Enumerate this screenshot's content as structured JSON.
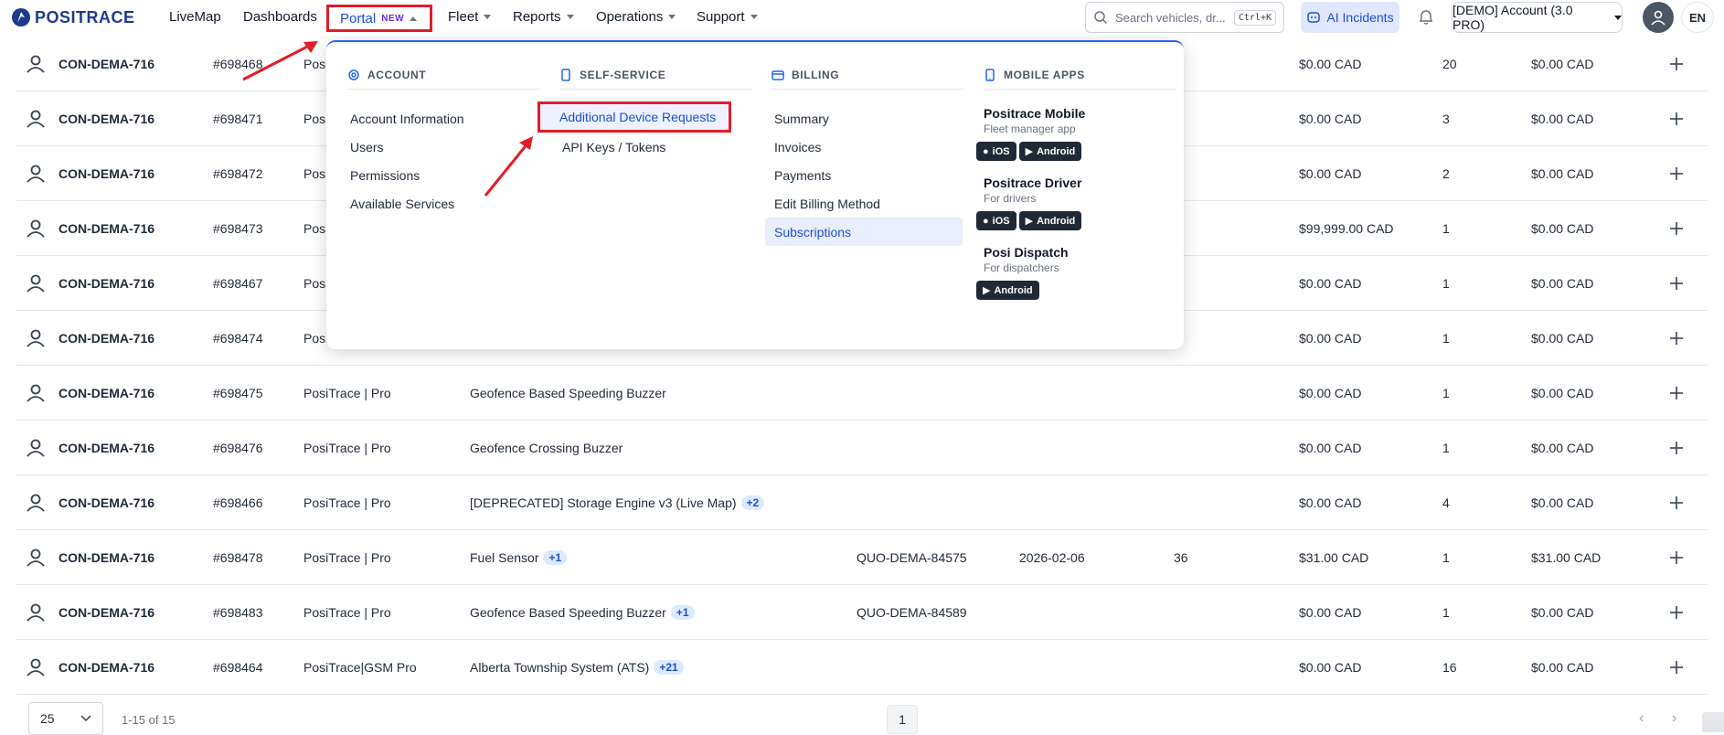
{
  "nav": {
    "logo": "POSITRACE",
    "items": [
      {
        "label": "LiveMap"
      },
      {
        "label": "Dashboards"
      },
      {
        "label": "Portal",
        "badge": "NEW"
      },
      {
        "label": "Fleet"
      },
      {
        "label": "Reports"
      },
      {
        "label": "Operations"
      },
      {
        "label": "Support"
      }
    ],
    "search_placeholder": "Search vehicles, dr...",
    "search_shortcut": "Ctrl+K",
    "ai_label": "AI Incidents",
    "account_label": "[DEMO] Account (3.0 PRO)",
    "lang": "EN"
  },
  "menu": {
    "account": {
      "header": "ACCOUNT",
      "items": [
        "Account Information",
        "Users",
        "Permissions",
        "Available Services"
      ]
    },
    "self_service": {
      "header": "SELF-SERVICE",
      "items": [
        "Additional Device Requests",
        "API Keys / Tokens"
      ]
    },
    "billing": {
      "header": "BILLING",
      "items": [
        "Summary",
        "Invoices",
        "Payments",
        "Edit Billing Method",
        "Subscriptions"
      ]
    },
    "mobile_apps": {
      "header": "MOBILE APPS",
      "apps": [
        {
          "name": "Positrace Mobile",
          "sub": "Fleet manager app",
          "ios": "iOS",
          "android": "Android"
        },
        {
          "name": "Positrace Driver",
          "sub": "For drivers",
          "ios": "iOS",
          "android": "Android"
        },
        {
          "name": "Posi Dispatch",
          "sub": "For dispatchers",
          "android": "Android"
        }
      ]
    }
  },
  "rows": [
    {
      "acct": "CON-DEMA-716",
      "id": "#698468",
      "plan": "Posi",
      "svc": "",
      "tag": "",
      "quote": "",
      "date": "",
      "n": "",
      "amt1": "$0.00 CAD",
      "qty": "20",
      "amt2": "$0.00 CAD"
    },
    {
      "acct": "CON-DEMA-716",
      "id": "#698471",
      "plan": "Posi",
      "svc": "",
      "tag": "",
      "quote": "",
      "date": "",
      "n": "",
      "amt1": "$0.00 CAD",
      "qty": "3",
      "amt2": "$0.00 CAD"
    },
    {
      "acct": "CON-DEMA-716",
      "id": "#698472",
      "plan": "Posi",
      "svc": "",
      "tag": "",
      "quote": "",
      "date": "",
      "n": "",
      "amt1": "$0.00 CAD",
      "qty": "2",
      "amt2": "$0.00 CAD"
    },
    {
      "acct": "CON-DEMA-716",
      "id": "#698473",
      "plan": "Posi",
      "svc": "",
      "tag": "",
      "quote": "",
      "date": "",
      "n": "",
      "amt1": "$99,999.00 CAD",
      "qty": "1",
      "amt2": "$0.00 CAD"
    },
    {
      "acct": "CON-DEMA-716",
      "id": "#698467",
      "plan": "Posi",
      "svc": "",
      "tag": "",
      "quote": "",
      "date": "",
      "n": "",
      "amt1": "$0.00 CAD",
      "qty": "1",
      "amt2": "$0.00 CAD"
    },
    {
      "acct": "CON-DEMA-716",
      "id": "#698474",
      "plan": "Posi",
      "svc": "",
      "tag": "",
      "quote": "",
      "date": "",
      "n": "",
      "amt1": "$0.00 CAD",
      "qty": "1",
      "amt2": "$0.00 CAD"
    },
    {
      "acct": "CON-DEMA-716",
      "id": "#698475",
      "plan": "PosiTrace | Pro",
      "svc": "Geofence Based Speeding Buzzer",
      "tag": "",
      "quote": "",
      "date": "",
      "n": "",
      "amt1": "$0.00 CAD",
      "qty": "1",
      "amt2": "$0.00 CAD"
    },
    {
      "acct": "CON-DEMA-716",
      "id": "#698476",
      "plan": "PosiTrace | Pro",
      "svc": "Geofence Crossing Buzzer",
      "tag": "",
      "quote": "",
      "date": "",
      "n": "",
      "amt1": "$0.00 CAD",
      "qty": "1",
      "amt2": "$0.00 CAD"
    },
    {
      "acct": "CON-DEMA-716",
      "id": "#698466",
      "plan": "PosiTrace | Pro",
      "svc": "[DEPRECATED] Storage Engine v3 (Live Map)",
      "tag": "+2",
      "quote": "",
      "date": "",
      "n": "",
      "amt1": "$0.00 CAD",
      "qty": "4",
      "amt2": "$0.00 CAD"
    },
    {
      "acct": "CON-DEMA-716",
      "id": "#698478",
      "plan": "PosiTrace | Pro",
      "svc": "Fuel Sensor",
      "tag": "+1",
      "quote": "QUO-DEMA-84575",
      "date": "2026-02-06",
      "n": "36",
      "amt1": "$31.00 CAD",
      "qty": "1",
      "amt2": "$31.00 CAD"
    },
    {
      "acct": "CON-DEMA-716",
      "id": "#698483",
      "plan": "PosiTrace | Pro",
      "svc": "Geofence Based Speeding Buzzer",
      "tag": "+1",
      "quote": "QUO-DEMA-84589",
      "date": "",
      "n": "",
      "amt1": "$0.00 CAD",
      "qty": "1",
      "amt2": "$0.00 CAD"
    },
    {
      "acct": "CON-DEMA-716",
      "id": "#698464",
      "plan": "PosiTrace|GSM Pro",
      "svc": "Alberta Township System (ATS)",
      "tag": "+21",
      "quote": "",
      "date": "",
      "n": "",
      "amt1": "$0.00 CAD",
      "qty": "16",
      "amt2": "$0.00 CAD"
    }
  ],
  "footer": {
    "page_size": "25",
    "range": "1-15 of 15",
    "page": "1"
  }
}
